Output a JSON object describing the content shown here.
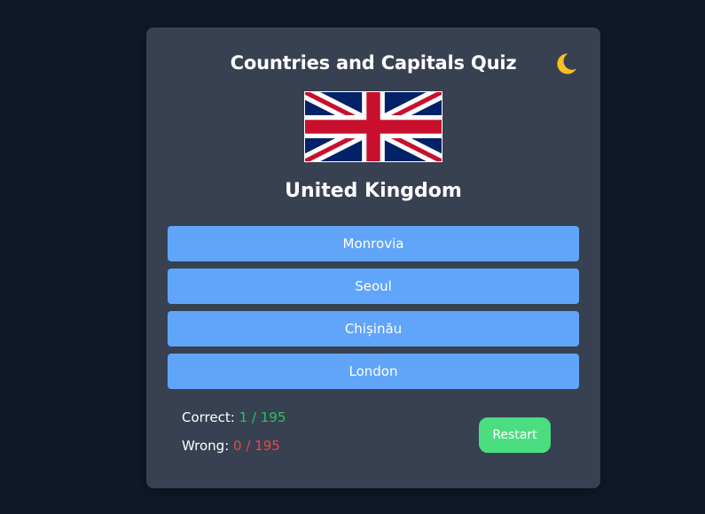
{
  "quiz": {
    "title": "Countries and Capitals Quiz",
    "country": "United Kingdom",
    "flag_icon": "united-kingdom-flag",
    "theme_icon": "moon-icon",
    "options": [
      "Monrovia",
      "Seoul",
      "Chișinău",
      "London"
    ],
    "score": {
      "correct_label": "Correct:",
      "correct_value": "1 / 195",
      "wrong_label": "Wrong:",
      "wrong_value": "0 / 195"
    },
    "restart_label": "Restart"
  },
  "colors": {
    "background": "#111827",
    "card": "#374151",
    "option": "#60a5fa",
    "restart": "#4ade80",
    "correct": "#22c55e",
    "wrong": "#ef4444",
    "moon": "#fbbf24"
  }
}
